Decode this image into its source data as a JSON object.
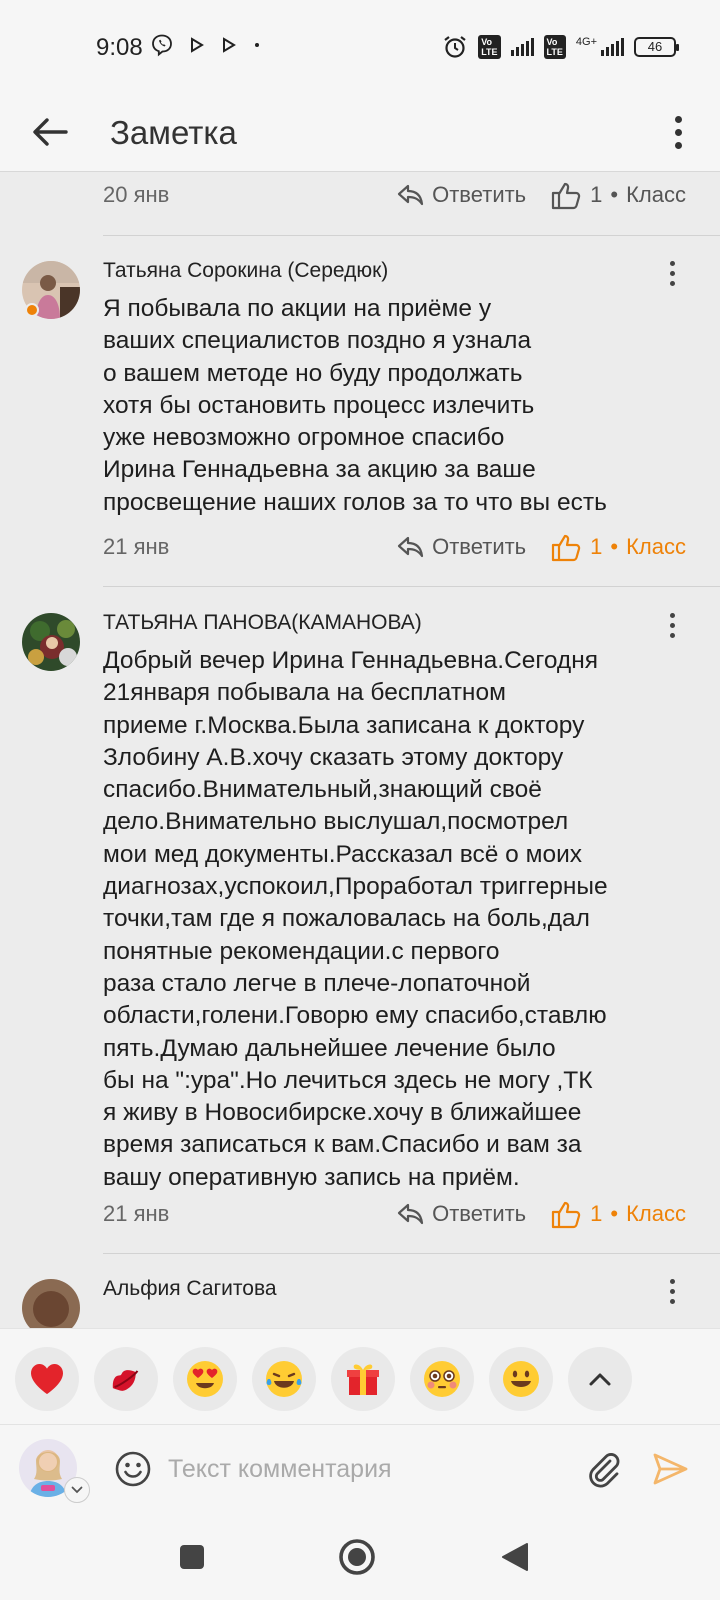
{
  "status_bar": {
    "time": "9:08",
    "network": "4G+",
    "battery": "46"
  },
  "header": {
    "title": "Заметка"
  },
  "actions": {
    "reply": "Ответить",
    "klass": "Класс"
  },
  "comments": [
    {
      "date": "20 янв",
      "likes": "1",
      "liked": false
    },
    {
      "author": "Татьяна Сорокина (Середюк)",
      "lines": [
        "Я побывала по акции на приёме у",
        "ваших специалистов поздно я узнала",
        "о вашем методе но буду продолжать",
        "хотя бы остановить процесс излечить",
        "уже невозможно огромное спасибо",
        "Ирина Геннадьевна за акцию за ваше",
        "просвещение наших голов за то что вы есть"
      ],
      "date": "21 янв",
      "likes": "1",
      "liked": true
    },
    {
      "author": "ТАТЬЯНА ПАНОВА(КАМАНОВА)",
      "lines": [
        "Добрый вечер Ирина Геннадьевна.Сегодня",
        "21января побывала на бесплатном",
        "приеме г.Москва.Была записана к доктору",
        "Злобину А.В.хочу сказать этому доктору",
        "спасибо.Внимательный,знающий своё",
        "дело.Внимательно выслушал,посмотрел",
        "мои мед документы.Рассказал всё о моих",
        "диагнозах,успокоил,Проработал триггерные",
        "точки,там где я пожаловалась на боль,дал",
        "понятные рекомендации.с первого",
        "раза стало легче в плече-лопаточной",
        "области,голени.Говорю ему спасибо,ставлю",
        "пять.Думаю дальнейшее лечение было",
        "бы на \":ура\".Но лечиться здесь не могу ,ТК",
        "я живу в Новосибирске.хочу в ближайшее",
        "время записаться к вам.Спасибо и вам за",
        "вашу оперативную запись на приём."
      ],
      "date": "21 янв",
      "likes": "1",
      "liked": true
    },
    {
      "author": "Альфия Сагитова"
    }
  ],
  "composer": {
    "placeholder": "Текст комментария"
  },
  "reactions": [
    "heart",
    "lips",
    "heart-eyes",
    "laugh-tears",
    "gift",
    "flushed",
    "smile",
    "expand"
  ],
  "colors": {
    "accent": "#ee8208",
    "background": "#ececec"
  }
}
